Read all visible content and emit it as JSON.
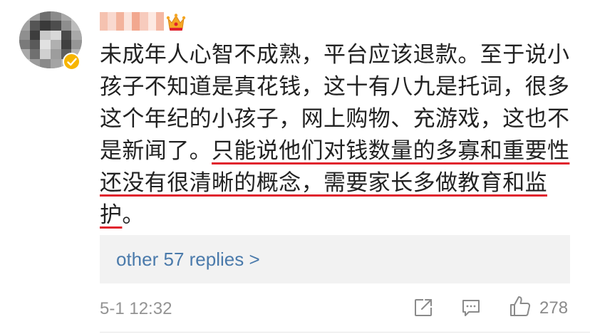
{
  "comment": {
    "username": "",
    "text_lines_plain_before": "未成年人心智不成熟，平台应该退款。至于说小孩子不知道是真花钱，这十有八九是托词，很多这个年纪的小孩子，网上购物、充游戏，这也不是新闻了。",
    "text_highlighted": "只能说他们对钱数量的多寡和重要性还没有很清晰的概念，需要家长多做教育和监护",
    "text_after": "。",
    "replies_label": "other 57 replies >",
    "timestamp": "5-1 12:32",
    "like_count": "278"
  },
  "colors": {
    "highlight_underline": "#e0222d",
    "link": "#4a7aab",
    "verified_badge": "#f7b500",
    "crown": "#f5a623"
  },
  "icons": {
    "verified": "verified-check-icon",
    "crown": "crown-icon",
    "share": "share-icon",
    "comment": "comment-icon",
    "like": "thumbs-up-icon"
  }
}
